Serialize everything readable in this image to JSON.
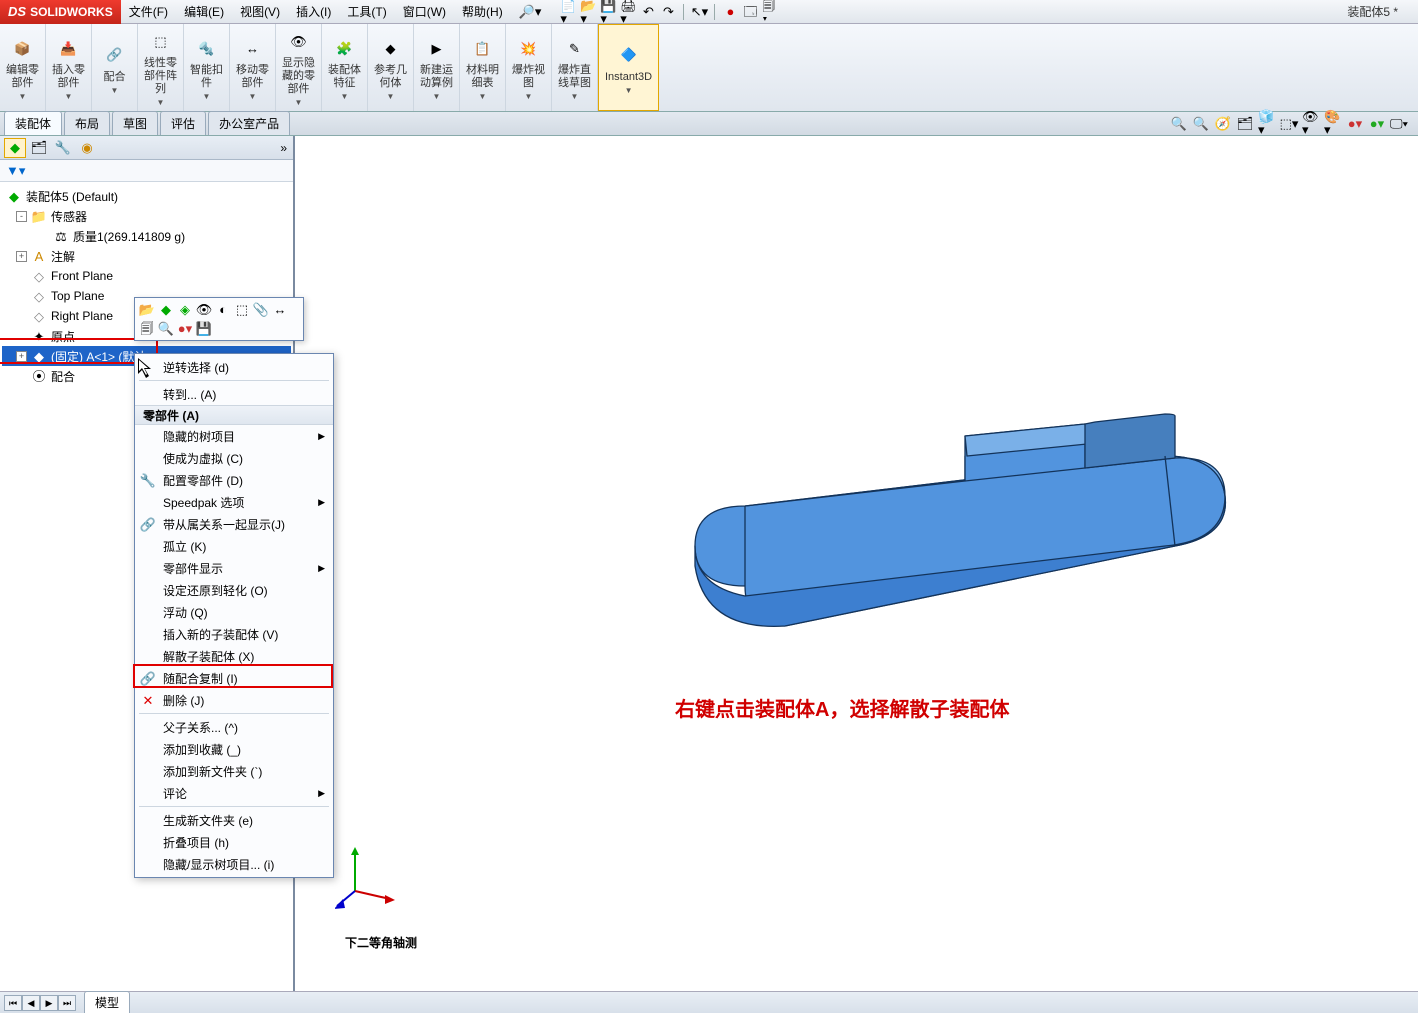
{
  "app": {
    "name": "SOLIDWORKS",
    "doc_title": "装配体5 *"
  },
  "menu": [
    "文件(F)",
    "编辑(E)",
    "视图(V)",
    "插入(I)",
    "工具(T)",
    "窗口(W)",
    "帮助(H)"
  ],
  "ribbon": [
    {
      "label": "编辑零\n部件",
      "icon": "📦"
    },
    {
      "label": "插入零\n部件",
      "icon": "📥"
    },
    {
      "label": "配合",
      "icon": "🔗"
    },
    {
      "label": "线性零\n部件阵\n列",
      "icon": "⬚"
    },
    {
      "label": "智能扣\n件",
      "icon": "🔩"
    },
    {
      "label": "移动零\n部件",
      "icon": "↔"
    },
    {
      "label": "显示隐\n藏的零\n部件",
      "icon": "👁"
    },
    {
      "label": "装配体\n特征",
      "icon": "🧩"
    },
    {
      "label": "参考几\n何体",
      "icon": "◆"
    },
    {
      "label": "新建运\n动算例",
      "icon": "▶"
    },
    {
      "label": "材料明\n细表",
      "icon": "📋"
    },
    {
      "label": "爆炸视\n图",
      "icon": "💥"
    },
    {
      "label": "爆炸直\n线草图",
      "icon": "✎"
    },
    {
      "label": "Instant3D",
      "icon": "🔷",
      "active": true
    }
  ],
  "tabs": [
    "装配体",
    "布局",
    "草图",
    "评估",
    "办公室产品"
  ],
  "active_tab": "装配体",
  "tree": {
    "root": "装配体5  (Default)",
    "sensors": "传感器",
    "mass": "质量1(269.141809 g)",
    "annotations": "注解",
    "front": "Front Plane",
    "top": "Top Plane",
    "right": "Right Plane",
    "origin": "原点",
    "fixed_part": "(固定) A<1> (默认",
    "mates": "配合"
  },
  "context_menu": {
    "invert": "逆转选择 (d)",
    "goto": "转到... (A)",
    "header": "零部件 (A)",
    "hidden_tree": "隐藏的树项目",
    "virtual": "使成为虚拟 (C)",
    "configure": "配置零部件 (D)",
    "speedpak": "Speedpak 选项",
    "with_dep": "带从属关系一起显示(J)",
    "isolate": "孤立 (K)",
    "display": "零部件显示",
    "lightweight": "设定还原到轻化 (O)",
    "float": "浮动 (Q)",
    "insert_sub": "插入新的子装配体 (V)",
    "dissolve": "解散子装配体 (X)",
    "copy_mates": "随配合复制 (I)",
    "delete": "删除 (J)",
    "parent_child": "父子关系... (^)",
    "add_fav": "添加到收藏 (_)",
    "add_folder": "添加到新文件夹 (`)",
    "comments": "评论",
    "new_folder": "生成新文件夹 (e)",
    "collapse": "折叠项目 (h)",
    "hide_show": "隐藏/显示树项目... (i)"
  },
  "annotation_text": "右键点击装配体A，选择解散子装配体",
  "viewport_caption": "下二等角轴测",
  "bottom_tab": "模型"
}
